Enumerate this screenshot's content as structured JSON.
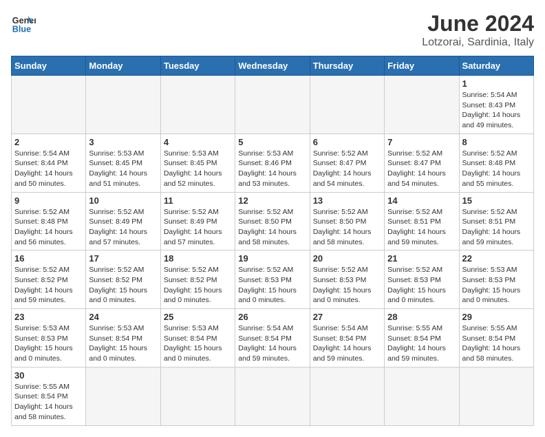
{
  "header": {
    "logo_line1": "General",
    "logo_line2": "Blue",
    "month": "June 2024",
    "location": "Lotzorai, Sardinia, Italy"
  },
  "weekdays": [
    "Sunday",
    "Monday",
    "Tuesday",
    "Wednesday",
    "Thursday",
    "Friday",
    "Saturday"
  ],
  "weeks": [
    [
      {
        "day": "",
        "info": ""
      },
      {
        "day": "",
        "info": ""
      },
      {
        "day": "",
        "info": ""
      },
      {
        "day": "",
        "info": ""
      },
      {
        "day": "",
        "info": ""
      },
      {
        "day": "",
        "info": ""
      },
      {
        "day": "1",
        "info": "Sunrise: 5:54 AM\nSunset: 8:43 PM\nDaylight: 14 hours\nand 49 minutes."
      }
    ],
    [
      {
        "day": "2",
        "info": "Sunrise: 5:54 AM\nSunset: 8:44 PM\nDaylight: 14 hours\nand 50 minutes."
      },
      {
        "day": "3",
        "info": "Sunrise: 5:53 AM\nSunset: 8:45 PM\nDaylight: 14 hours\nand 51 minutes."
      },
      {
        "day": "4",
        "info": "Sunrise: 5:53 AM\nSunset: 8:45 PM\nDaylight: 14 hours\nand 52 minutes."
      },
      {
        "day": "5",
        "info": "Sunrise: 5:53 AM\nSunset: 8:46 PM\nDaylight: 14 hours\nand 53 minutes."
      },
      {
        "day": "6",
        "info": "Sunrise: 5:52 AM\nSunset: 8:47 PM\nDaylight: 14 hours\nand 54 minutes."
      },
      {
        "day": "7",
        "info": "Sunrise: 5:52 AM\nSunset: 8:47 PM\nDaylight: 14 hours\nand 54 minutes."
      },
      {
        "day": "8",
        "info": "Sunrise: 5:52 AM\nSunset: 8:48 PM\nDaylight: 14 hours\nand 55 minutes."
      }
    ],
    [
      {
        "day": "9",
        "info": "Sunrise: 5:52 AM\nSunset: 8:48 PM\nDaylight: 14 hours\nand 56 minutes."
      },
      {
        "day": "10",
        "info": "Sunrise: 5:52 AM\nSunset: 8:49 PM\nDaylight: 14 hours\nand 57 minutes."
      },
      {
        "day": "11",
        "info": "Sunrise: 5:52 AM\nSunset: 8:49 PM\nDaylight: 14 hours\nand 57 minutes."
      },
      {
        "day": "12",
        "info": "Sunrise: 5:52 AM\nSunset: 8:50 PM\nDaylight: 14 hours\nand 58 minutes."
      },
      {
        "day": "13",
        "info": "Sunrise: 5:52 AM\nSunset: 8:50 PM\nDaylight: 14 hours\nand 58 minutes."
      },
      {
        "day": "14",
        "info": "Sunrise: 5:52 AM\nSunset: 8:51 PM\nDaylight: 14 hours\nand 59 minutes."
      },
      {
        "day": "15",
        "info": "Sunrise: 5:52 AM\nSunset: 8:51 PM\nDaylight: 14 hours\nand 59 minutes."
      }
    ],
    [
      {
        "day": "16",
        "info": "Sunrise: 5:52 AM\nSunset: 8:52 PM\nDaylight: 14 hours\nand 59 minutes."
      },
      {
        "day": "17",
        "info": "Sunrise: 5:52 AM\nSunset: 8:52 PM\nDaylight: 15 hours\nand 0 minutes."
      },
      {
        "day": "18",
        "info": "Sunrise: 5:52 AM\nSunset: 8:52 PM\nDaylight: 15 hours\nand 0 minutes."
      },
      {
        "day": "19",
        "info": "Sunrise: 5:52 AM\nSunset: 8:53 PM\nDaylight: 15 hours\nand 0 minutes."
      },
      {
        "day": "20",
        "info": "Sunrise: 5:52 AM\nSunset: 8:53 PM\nDaylight: 15 hours\nand 0 minutes."
      },
      {
        "day": "21",
        "info": "Sunrise: 5:52 AM\nSunset: 8:53 PM\nDaylight: 15 hours\nand 0 minutes."
      },
      {
        "day": "22",
        "info": "Sunrise: 5:53 AM\nSunset: 8:53 PM\nDaylight: 15 hours\nand 0 minutes."
      }
    ],
    [
      {
        "day": "23",
        "info": "Sunrise: 5:53 AM\nSunset: 8:53 PM\nDaylight: 15 hours\nand 0 minutes."
      },
      {
        "day": "24",
        "info": "Sunrise: 5:53 AM\nSunset: 8:54 PM\nDaylight: 15 hours\nand 0 minutes."
      },
      {
        "day": "25",
        "info": "Sunrise: 5:53 AM\nSunset: 8:54 PM\nDaylight: 15 hours\nand 0 minutes."
      },
      {
        "day": "26",
        "info": "Sunrise: 5:54 AM\nSunset: 8:54 PM\nDaylight: 14 hours\nand 59 minutes."
      },
      {
        "day": "27",
        "info": "Sunrise: 5:54 AM\nSunset: 8:54 PM\nDaylight: 14 hours\nand 59 minutes."
      },
      {
        "day": "28",
        "info": "Sunrise: 5:55 AM\nSunset: 8:54 PM\nDaylight: 14 hours\nand 59 minutes."
      },
      {
        "day": "29",
        "info": "Sunrise: 5:55 AM\nSunset: 8:54 PM\nDaylight: 14 hours\nand 58 minutes."
      }
    ],
    [
      {
        "day": "30",
        "info": "Sunrise: 5:55 AM\nSunset: 8:54 PM\nDaylight: 14 hours\nand 58 minutes."
      },
      {
        "day": "",
        "info": ""
      },
      {
        "day": "",
        "info": ""
      },
      {
        "day": "",
        "info": ""
      },
      {
        "day": "",
        "info": ""
      },
      {
        "day": "",
        "info": ""
      },
      {
        "day": "",
        "info": ""
      }
    ]
  ]
}
